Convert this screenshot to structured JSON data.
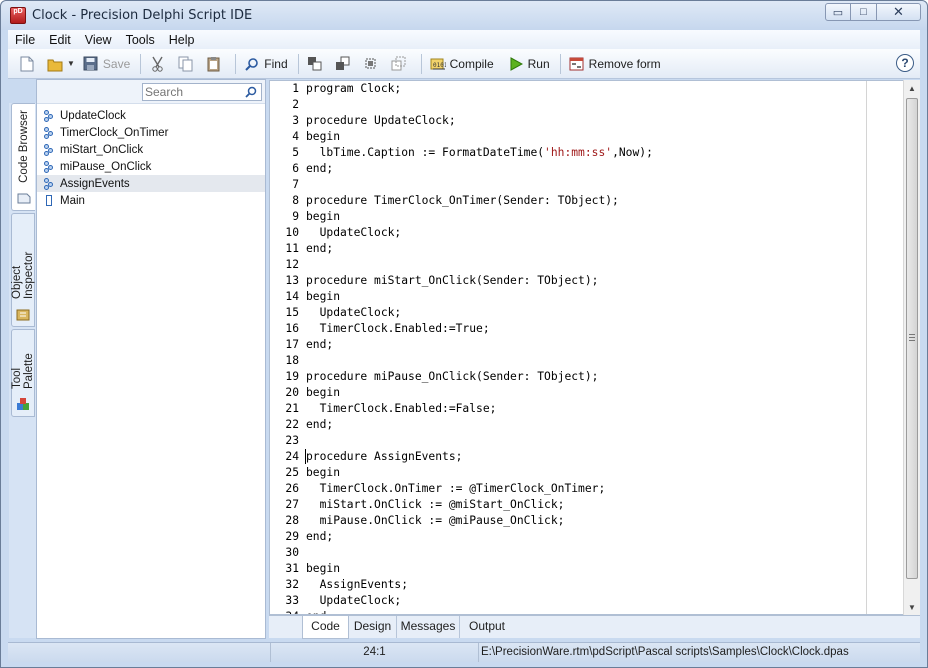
{
  "window": {
    "title": "Clock - Precision Delphi Script IDE",
    "icon_text": "pD",
    "controls": {
      "minimize": "▭",
      "maximize": "□",
      "close": "✕"
    }
  },
  "menu": [
    "File",
    "Edit",
    "View",
    "Tools",
    "Help"
  ],
  "toolbar": {
    "save_label": "Save",
    "find_label": "Find",
    "compile_label": "Compile",
    "run_label": "Run",
    "remove_form_label": "Remove form",
    "help_label": "?"
  },
  "side_tabs": [
    "Code Browser",
    "Object Inspector",
    "Tool Palette"
  ],
  "browser": {
    "search_placeholder": "Search",
    "items": [
      {
        "label": "UpdateClock",
        "selected": false
      },
      {
        "label": "TimerClock_OnTimer",
        "selected": false
      },
      {
        "label": "miStart_OnClick",
        "selected": false
      },
      {
        "label": "miPause_OnClick",
        "selected": false
      },
      {
        "label": "AssignEvents",
        "selected": true
      },
      {
        "label": "Main",
        "selected": false
      }
    ]
  },
  "editor": {
    "lines": [
      "program Clock;",
      "",
      "procedure UpdateClock;",
      "begin",
      "  lbTime.Caption := FormatDateTime('hh:mm:ss',Now);",
      "end;",
      "",
      "procedure TimerClock_OnTimer(Sender: TObject);",
      "begin",
      "  UpdateClock;",
      "end;",
      "",
      "procedure miStart_OnClick(Sender: TObject);",
      "begin",
      "  UpdateClock;",
      "  TimerClock.Enabled:=True;",
      "end;",
      "",
      "procedure miPause_OnClick(Sender: TObject);",
      "begin",
      "  TimerClock.Enabled:=False;",
      "end;",
      "",
      "procedure AssignEvents;",
      "begin",
      "  TimerClock.OnTimer := @TimerClock_OnTimer;",
      "  miStart.OnClick := @miStart_OnClick;",
      "  miPause.OnClick := @miPause_OnClick;",
      "end;",
      "",
      "begin",
      "  AssignEvents;",
      "  UpdateClock;",
      "end."
    ],
    "string_color": "#a01b1b"
  },
  "bottom_tabs": [
    {
      "label": "Code",
      "active": true
    },
    {
      "label": "Design",
      "active": false
    },
    {
      "label": "Messages",
      "active": false
    },
    {
      "label": "Output",
      "active": false
    }
  ],
  "status": {
    "cursor_pos": "24:1",
    "file_path": "E:\\PrecisionWare.rtm\\pdScript\\Pascal scripts\\Samples\\Clock\\Clock.dpas"
  },
  "colors": {
    "chrome": "#c9daf0",
    "selection": "#e4e8ee",
    "accent": "#2f68b6"
  }
}
